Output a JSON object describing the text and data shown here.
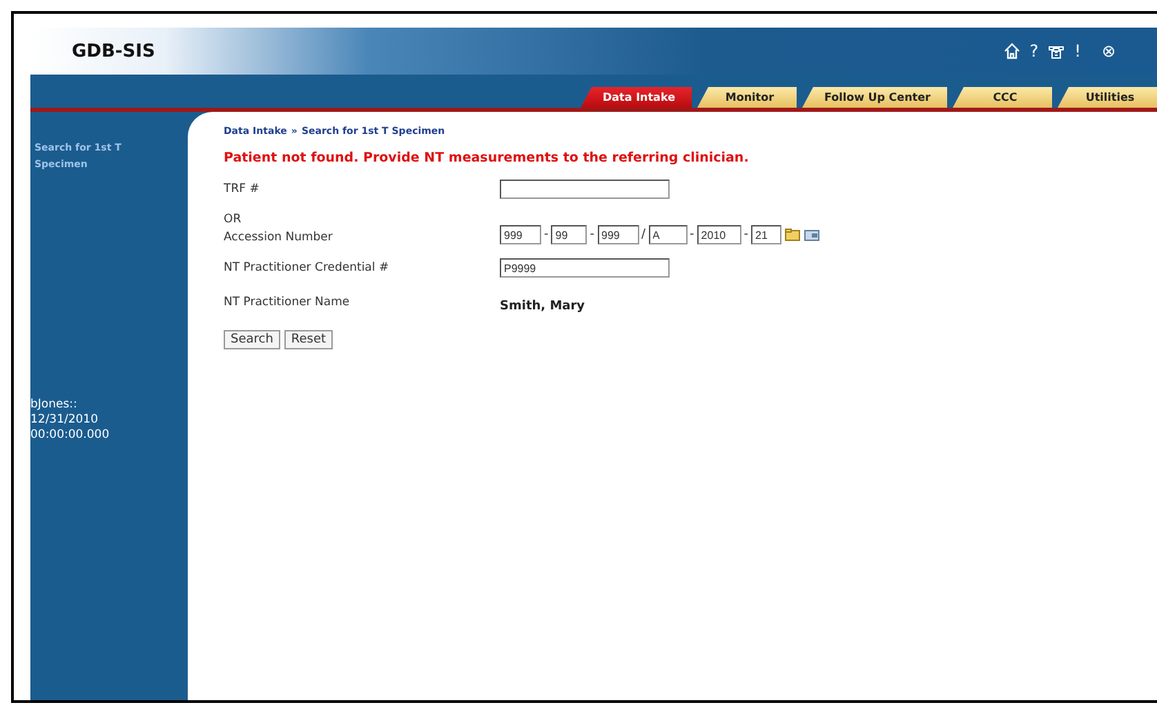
{
  "header": {
    "logo": "GDB-SIS",
    "help": "?",
    "alert": "!",
    "close": "⊗"
  },
  "tabs": [
    {
      "label": "Data Intake",
      "selected": true
    },
    {
      "label": "Monitor",
      "selected": false
    },
    {
      "label": "Follow Up Center",
      "selected": false
    },
    {
      "label": "CCC",
      "selected": false
    },
    {
      "label": "Utilities",
      "selected": false
    }
  ],
  "sidebar": {
    "title": "Search for 1st T Specimen",
    "user": "bJones::",
    "date": "12/31/2010",
    "time": "00:00:00.000"
  },
  "breadcrumb": {
    "parent": "Data Intake",
    "separator": "»",
    "current": "Search for 1st T Specimen"
  },
  "error": "Patient not found. Provide NT measurements to the referring clinician.",
  "form": {
    "trf_label": "TRF #",
    "or_label": "OR",
    "accession_label": "Accession Number",
    "accession": [
      {
        "value": "999"
      },
      {
        "sep": "-",
        "value": "99"
      },
      {
        "sep": "-",
        "value": "999"
      },
      {
        "sep": "/",
        "value": "A"
      },
      {
        "sep": "-",
        "value": "2010"
      },
      {
        "sep": "-",
        "value": "21"
      }
    ],
    "credential_label": "NT Practitioner Credential #",
    "credential": "P9999",
    "name_label": "NT Practitioner Name",
    "name": "Smith, Mary"
  },
  "buttons": [
    "Search",
    "Reset"
  ]
}
